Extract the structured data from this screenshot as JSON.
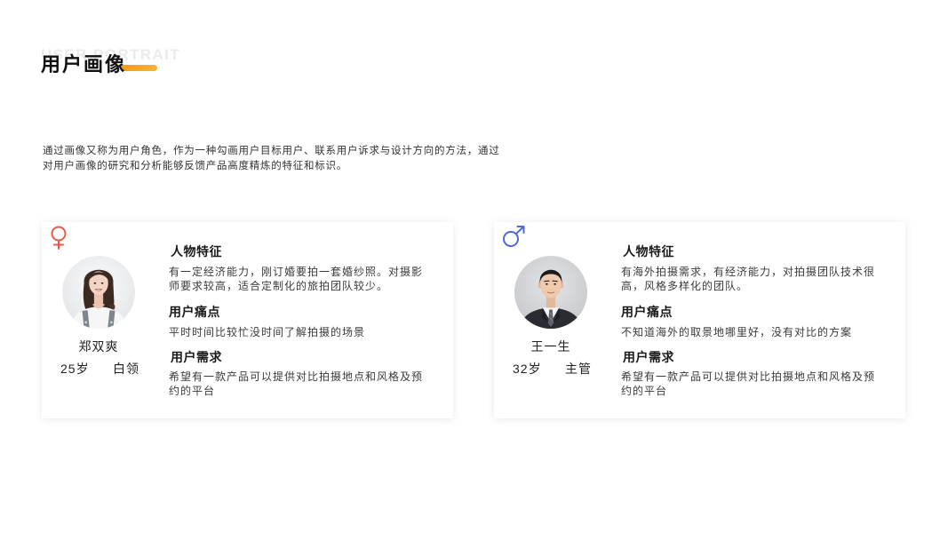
{
  "header": {
    "watermark": "USER PORTRAIT",
    "title": "用户画像"
  },
  "intro": {
    "lines": [
      "通过画像又称为用户角色，作为一种勾画用户目标用户、联系用户诉求与设计方向的方法，通过",
      "对用户画像的研究和分析能够反馈产品高度精炼的特征和标识。"
    ]
  },
  "personas": [
    {
      "gender_icon": "female-symbol-icon",
      "avatar": "woman-portrait-photo",
      "name": "郑双爽",
      "age": "25岁",
      "occupation": "白领",
      "sections": [
        {
          "heading": "人物特征",
          "lines": [
            "有一定经济能力，刚订婚要拍一套婚纱照。对摄影",
            "师要求较高，适合定制化的旅拍团队较少。"
          ]
        },
        {
          "heading": "用户痛点",
          "lines": [
            "平时时间比较忙没时间了解拍摄的场景"
          ]
        },
        {
          "heading": "用户需求",
          "lines": [
            "希望有一款产品可以提供对比拍摄地点和风格及预",
            "约的平台"
          ]
        }
      ]
    },
    {
      "gender_icon": "male-symbol-icon",
      "avatar": "man-in-suit-portrait-photo",
      "name": "王一生",
      "age": "32岁",
      "occupation": "主管",
      "sections": [
        {
          "heading": "人物特征",
          "lines": [
            "有海外拍摄需求，有经济能力，对拍摄团队技术很",
            "高，风格多样化的团队。"
          ]
        },
        {
          "heading": "用户痛点",
          "lines": [
            "不知道海外的取景地哪里好，没有对比的方案"
          ]
        },
        {
          "heading": "用户需求",
          "lines": [
            "希望有一款产品可以提供对比拍摄地点和风格及预",
            "约的平台"
          ]
        }
      ]
    }
  ],
  "colors": {
    "accent_start": "#F39A1C",
    "accent_end": "#F8B23A",
    "female": "#E95A48",
    "male": "#4A6BD6"
  }
}
